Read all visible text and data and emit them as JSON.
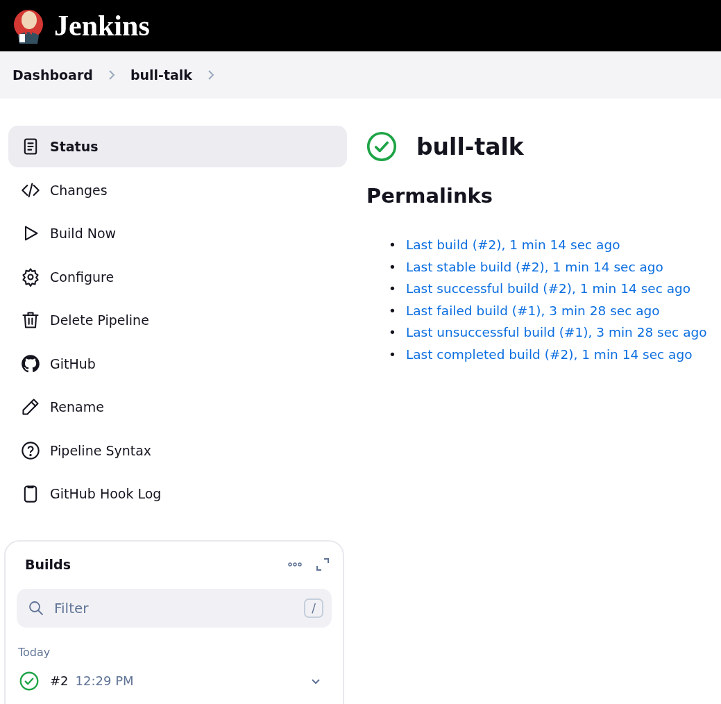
{
  "header": {
    "title": "Jenkins"
  },
  "breadcrumbs": [
    "Dashboard",
    "bull-talk"
  ],
  "sidebar": {
    "items": [
      {
        "label": "Status",
        "kind": "status",
        "selected": true
      },
      {
        "label": "Changes",
        "kind": "code",
        "selected": false
      },
      {
        "label": "Build Now",
        "kind": "play",
        "selected": false
      },
      {
        "label": "Configure",
        "kind": "gear",
        "selected": false
      },
      {
        "label": "Delete Pipeline",
        "kind": "trash",
        "selected": false
      },
      {
        "label": "GitHub",
        "kind": "github",
        "selected": false
      },
      {
        "label": "Rename",
        "kind": "pencil",
        "selected": false
      },
      {
        "label": "Pipeline Syntax",
        "kind": "help",
        "selected": false
      },
      {
        "label": "GitHub Hook Log",
        "kind": "clipboard",
        "selected": false
      }
    ]
  },
  "builds": {
    "title": "Builds",
    "filter": {
      "placeholder": "Filter",
      "shortcut": "/"
    },
    "group": "Today",
    "items": [
      {
        "number": "#2",
        "time": "12:29 PM",
        "passed": true
      }
    ]
  },
  "job": {
    "title": "bull-talk",
    "passed": true
  },
  "permalinks": {
    "title": "Permalinks",
    "links": [
      {
        "bullet": "•",
        "text": "Last build (#2), 1 min 14 sec ago"
      },
      {
        "bullet": "•",
        "text": "Last stable build (#2), 1 min 14 sec ago"
      },
      {
        "bullet": "•",
        "text": "Last successful build (#2), 1 min 14 sec ago"
      },
      {
        "bullet": "•",
        "text": "Last failed build (#1), 3 min 28 sec ago"
      },
      {
        "bullet": "•",
        "text": "Last unsuccessful build (#1), 3 min 28 sec ago"
      },
      {
        "bullet": "•",
        "text": "Last completed build (#2), 1 min 14 sec ago"
      }
    ]
  }
}
